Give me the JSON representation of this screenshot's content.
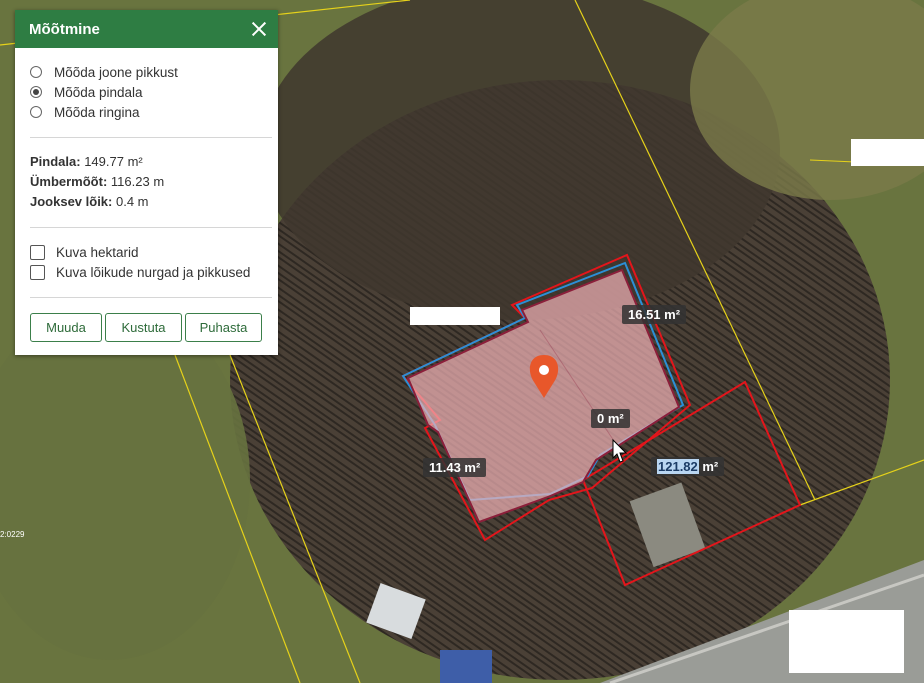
{
  "panel": {
    "title": "Mõõtmine",
    "options": [
      {
        "label": "Mõõda joone pikkust",
        "checked": false
      },
      {
        "label": "Mõõda pindala",
        "checked": true
      },
      {
        "label": "Mõõda ringina",
        "checked": false
      }
    ],
    "stats": {
      "area_label": "Pindala:",
      "area_value": "149.77 m²",
      "perimeter_label": "Ümbermõõt:",
      "perimeter_value": "116.23 m",
      "segment_label": "Jooksev lõik:",
      "segment_value": "0.4 m"
    },
    "checkboxes": [
      {
        "label": "Kuva hektarid",
        "checked": false
      },
      {
        "label": "Kuva lõikude nurgad ja pikkused",
        "checked": false
      }
    ],
    "buttons": {
      "edit": "Muuda",
      "delete": "Kustuta",
      "clear": "Puhasta"
    }
  },
  "map": {
    "labels": {
      "top_right": "16.51 m²",
      "center": "0 m²",
      "left": "11.43 m²",
      "right_selected": "121.82",
      "right_unit": " m²"
    },
    "parcel_code": "2:0229",
    "colors": {
      "measure_fill": "#f4b3b8",
      "measure_stroke": "#8b1f3a",
      "blue_outline": "#2b8fd6",
      "red_outline": "#e3151b",
      "parcel_line": "#e6d21a",
      "marker": "#e8572a",
      "header": "#2e7d43"
    }
  }
}
